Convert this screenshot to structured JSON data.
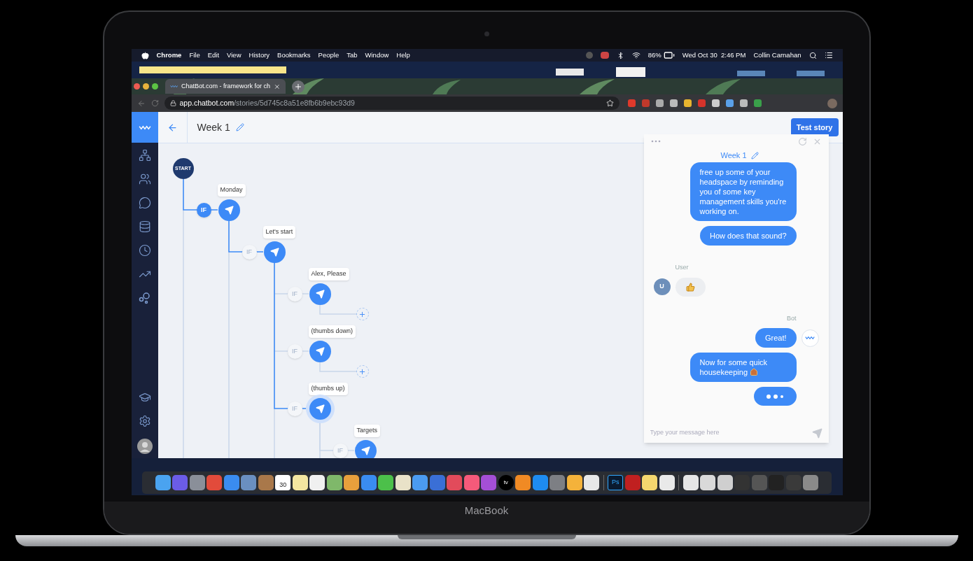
{
  "menubar": {
    "app": "Chrome",
    "menus": [
      "File",
      "Edit",
      "View",
      "History",
      "Bookmarks",
      "People",
      "Tab",
      "Window",
      "Help"
    ],
    "battery": "86%",
    "clock": "Wed Oct 30  2:46 PM",
    "user": "Collin Carnahan"
  },
  "browser": {
    "tabs": [
      {
        "title": "ChatBot.com - framework for ch",
        "selected": true
      }
    ],
    "url_host": "app.chatbot.com",
    "url_path": "/stories/5d745c8a51e8fb6b9ebc93d9"
  },
  "app": {
    "title": "Week 1",
    "test_button": "Test story"
  },
  "flow": {
    "start": "START",
    "children": [
      {
        "label": "Monday",
        "condition": "IF",
        "condition_highlighted": true,
        "active": true,
        "selected": false,
        "children": [
          {
            "label": "Let's start",
            "condition": "IF",
            "condition_highlighted": false,
            "active": true,
            "selected": false,
            "children": [
              {
                "label": "Alex, Please",
                "condition": "IF",
                "condition_highlighted": false,
                "active": false,
                "selected": false
              },
              {
                "label": "(thumbs down)",
                "condition": "IF",
                "condition_highlighted": false,
                "active": false,
                "selected": false
              },
              {
                "label": "(thumbs up)",
                "condition": "IF",
                "condition_highlighted": false,
                "active": true,
                "selected": true,
                "children": [
                  {
                    "label": "Targets",
                    "condition": "IF",
                    "condition_highlighted": false,
                    "active": false,
                    "selected": false
                  }
                ]
              }
            ]
          }
        ]
      }
    ]
  },
  "chat": {
    "title": "Week 1",
    "placeholder": "Type your message here",
    "messages": [
      {
        "kind": "bot",
        "text": "free up some of your headspace by reminding you of some key management skills you're working on."
      },
      {
        "kind": "bot",
        "text": "How does that sound?"
      },
      {
        "kind": "sender",
        "text": "User"
      },
      {
        "kind": "user_reaction",
        "avatar": "U"
      },
      {
        "kind": "sender",
        "text": "Bot"
      },
      {
        "kind": "bot_with_avatar",
        "text": "Great!"
      },
      {
        "kind": "bot_with_house",
        "text": "Now for some quick housekeeping"
      },
      {
        "kind": "typing"
      }
    ]
  },
  "dock": {
    "calendar_day": "30",
    "ps_label": "Ps",
    "tv_label": "tv"
  },
  "laptop": {
    "brand": "MacBook"
  }
}
